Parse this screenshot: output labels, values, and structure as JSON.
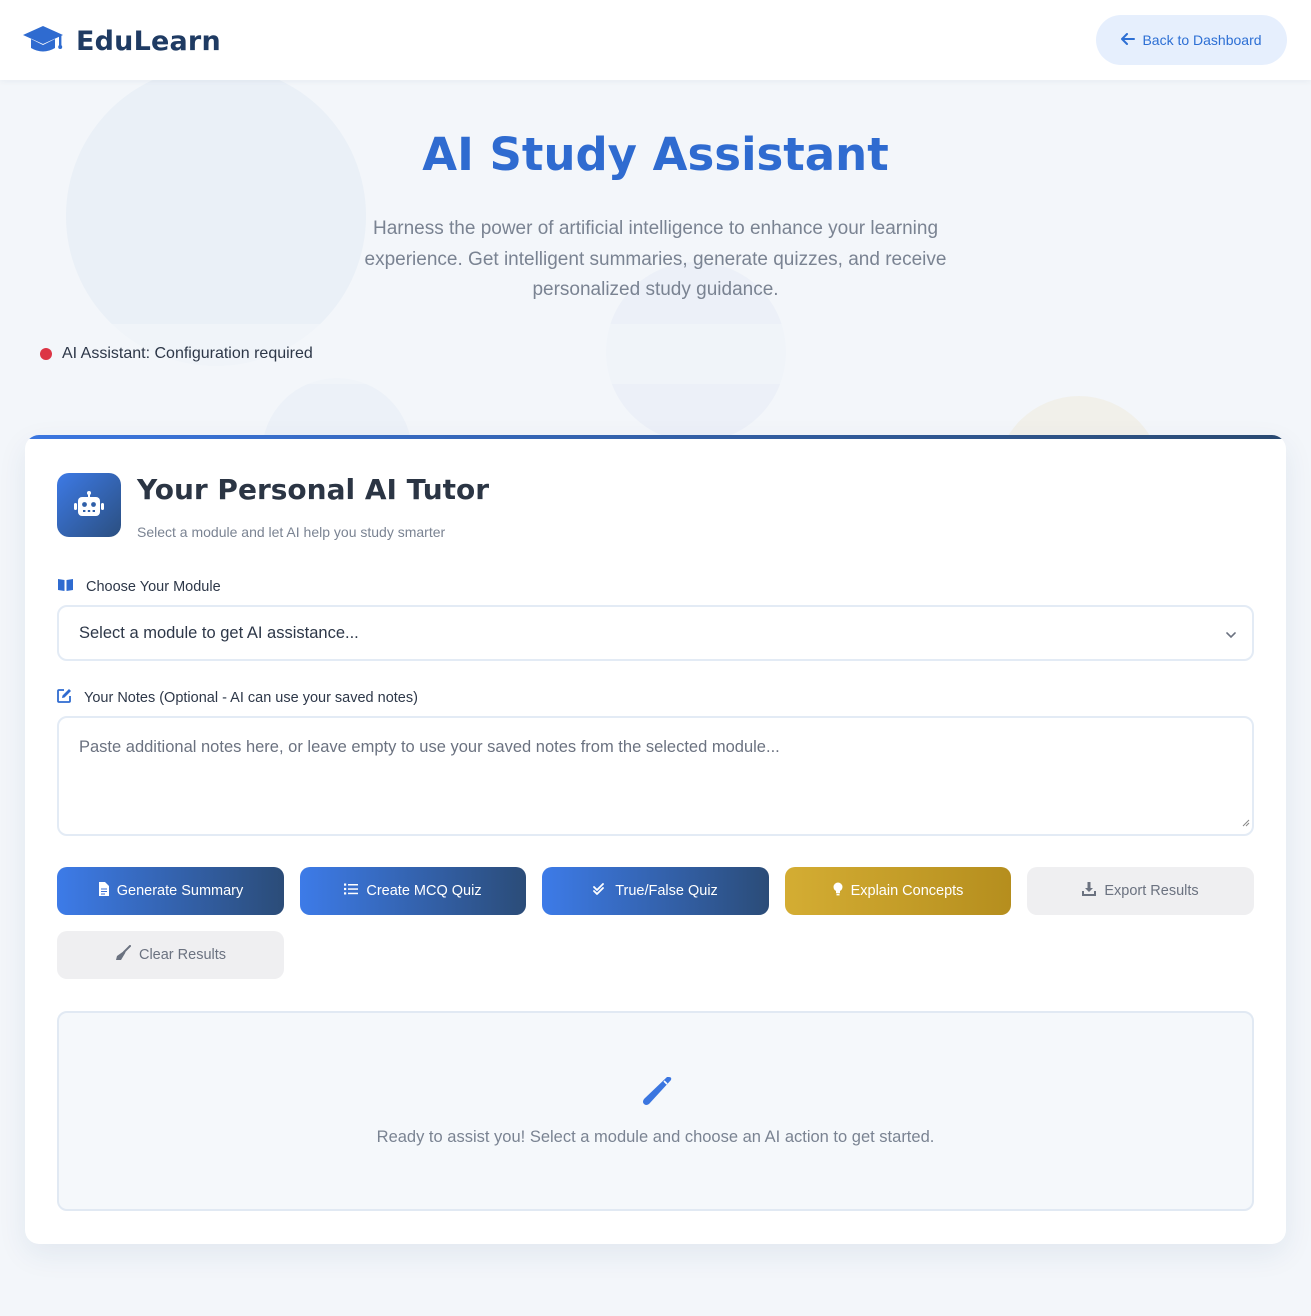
{
  "header": {
    "brand": "EduLearn",
    "back_label": "Back to Dashboard"
  },
  "hero": {
    "title": "AI Study Assistant",
    "subtitle": "Harness the power of artificial intelligence to enhance your learning experience. Get intelligent summaries, generate quizzes, and receive personalized study guidance."
  },
  "status": {
    "text": "AI Assistant: Configuration required",
    "color": "#dc3545"
  },
  "tutor": {
    "title": "Your Personal AI Tutor",
    "subtitle": "Select a module and let AI help you study smarter"
  },
  "module": {
    "label": "Choose Your Module",
    "selected": "Select a module to get AI assistance..."
  },
  "notes": {
    "label": "Your Notes (Optional - AI can use your saved notes)",
    "placeholder": "Paste additional notes here, or leave empty to use your saved notes from the selected module..."
  },
  "actions": {
    "summary": "Generate Summary",
    "mcq": "Create MCQ Quiz",
    "truefalse": "True/False Quiz",
    "explain": "Explain Concepts",
    "export": "Export Results",
    "clear": "Clear Results"
  },
  "result": {
    "message": "Ready to assist you! Select a module and choose an AI action to get started."
  },
  "colors": {
    "primary": "#3b76e0",
    "dark": "#2b4c78",
    "gold": "#c9a227",
    "brand_text": "#1f3b63"
  }
}
